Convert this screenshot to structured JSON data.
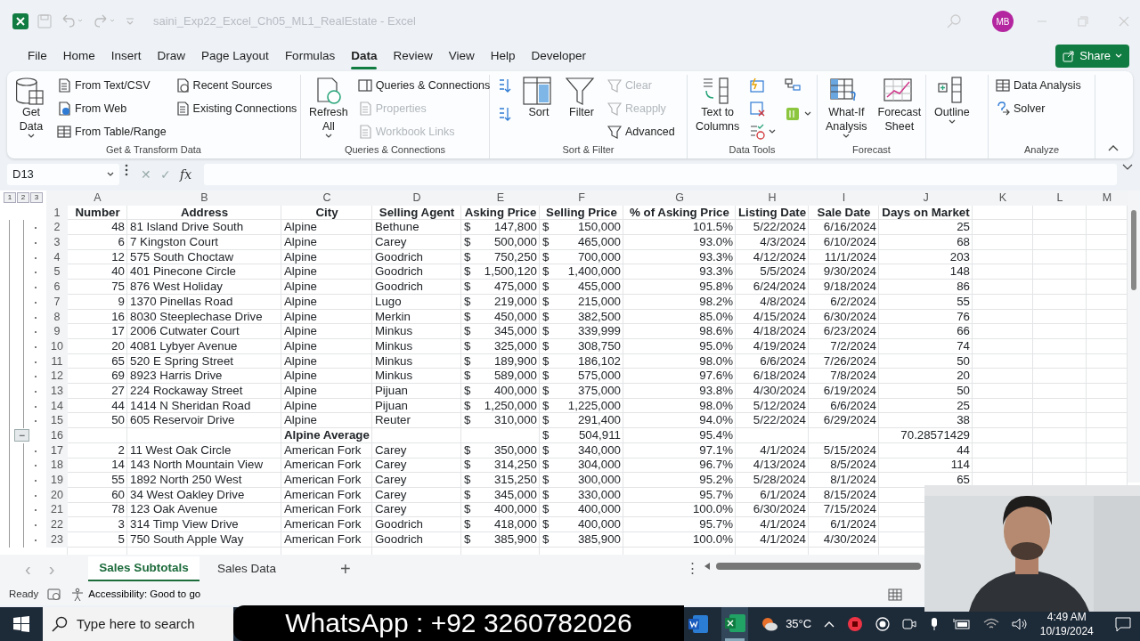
{
  "title_bar": {
    "title": "saini_Exp22_Excel_Ch05_ML1_RealEstate  -  Excel",
    "avatar": "MB"
  },
  "menu_tabs": [
    {
      "label": "File",
      "selected": false
    },
    {
      "label": "Home",
      "selected": false
    },
    {
      "label": "Insert",
      "selected": false
    },
    {
      "label": "Draw",
      "selected": false
    },
    {
      "label": "Page Layout",
      "selected": false
    },
    {
      "label": "Formulas",
      "selected": false
    },
    {
      "label": "Data",
      "selected": true
    },
    {
      "label": "Review",
      "selected": false
    },
    {
      "label": "View",
      "selected": false
    },
    {
      "label": "Help",
      "selected": false
    },
    {
      "label": "Developer",
      "selected": false
    }
  ],
  "share_button": {
    "label": "Share"
  },
  "ribbon": [
    {
      "label": "Get & Transform Data",
      "columns": [
        [
          {
            "kind": "large",
            "lines": [
              "Get",
              "Data"
            ],
            "dropdown": true,
            "disabled": false
          }
        ],
        [
          {
            "kind": "small",
            "label": "From Text/CSV",
            "disabled": false
          },
          {
            "kind": "small",
            "label": "From Web",
            "disabled": false
          },
          {
            "kind": "small",
            "label": "From Table/Range",
            "disabled": false
          }
        ],
        [
          {
            "kind": "small",
            "label": "Recent Sources",
            "disabled": false
          },
          {
            "kind": "small",
            "label": "Existing Connections",
            "disabled": false
          }
        ]
      ]
    },
    {
      "label": "Queries & Connections",
      "columns": [
        [
          {
            "kind": "large",
            "lines": [
              "Refresh",
              "All"
            ],
            "dropdown": true,
            "disabled": false
          }
        ],
        [
          {
            "kind": "small",
            "label": "Queries & Connections",
            "disabled": false
          },
          {
            "kind": "small",
            "label": "Properties",
            "disabled": true
          },
          {
            "kind": "small",
            "label": "Workbook Links",
            "disabled": true
          }
        ]
      ]
    },
    {
      "label": "Sort & Filter",
      "columns": [
        [
          {
            "kind": "icon",
            "disabled": false
          },
          {
            "kind": "icon",
            "disabled": false
          }
        ],
        [
          {
            "kind": "large",
            "lines": [
              "Sort"
            ],
            "disabled": false
          }
        ],
        [
          {
            "kind": "large",
            "lines": [
              "Filter"
            ],
            "disabled": false
          }
        ],
        [
          {
            "kind": "small",
            "label": "Clear",
            "disabled": true
          },
          {
            "kind": "small",
            "label": "Reapply",
            "disabled": true
          },
          {
            "kind": "small",
            "label": "Advanced",
            "disabled": false
          }
        ]
      ]
    },
    {
      "label": "Data Tools",
      "columns": [
        [
          {
            "kind": "large",
            "lines": [
              "Text to",
              "Columns"
            ],
            "disabled": false
          }
        ],
        [
          {
            "kind": "icon",
            "disabled": false
          },
          {
            "kind": "icon",
            "disabled": false
          },
          {
            "kind": "icon",
            "dropdown": true,
            "disabled": false
          }
        ],
        [
          {
            "kind": "icon",
            "disabled": false
          },
          {
            "kind": "icon",
            "dropdown": true,
            "disabled": false
          }
        ]
      ]
    },
    {
      "label": "Forecast",
      "columns": [
        [
          {
            "kind": "large",
            "lines": [
              "What-If",
              "Analysis"
            ],
            "dropdown": true,
            "disabled": false
          }
        ],
        [
          {
            "kind": "large",
            "lines": [
              "Forecast",
              "Sheet"
            ],
            "disabled": false
          }
        ]
      ]
    },
    {
      "columns": [
        [
          {
            "kind": "large",
            "lines": [
              "Outline"
            ],
            "dropdown": true,
            "disabled": false
          }
        ]
      ]
    },
    {
      "label": "Analyze",
      "columns": [
        [
          {
            "kind": "small",
            "label": "Data Analysis",
            "disabled": false
          },
          {
            "kind": "small",
            "label": "Solver",
            "disabled": false
          }
        ]
      ]
    }
  ],
  "formula_bar": {
    "name_box": "D13",
    "cancel": "✕",
    "enter": "✓",
    "fx": "fx"
  },
  "outline_levels": [
    "1",
    "2",
    "3"
  ],
  "columns": [
    "A",
    "B",
    "C",
    "D",
    "E",
    "F",
    "G",
    "H",
    "I",
    "J",
    "K",
    "L",
    "M"
  ],
  "rows": [
    {
      "n": "1",
      "kind": "header",
      "detail": false,
      "cells": [
        "Number",
        "Address",
        "City",
        "Selling Agent",
        "Asking Price",
        "Selling Price",
        "% of Asking Price",
        "Listing Date",
        "Sale Date",
        "Days on Market"
      ]
    },
    {
      "n": "2",
      "kind": "data",
      "detail": true,
      "cells": [
        "48",
        "81 Island Drive South",
        "Alpine",
        "Bethune",
        {
          "sym": "$",
          "val": "147,800"
        },
        {
          "sym": "$",
          "val": "150,000"
        },
        "101.5%",
        "5/22/2024",
        "6/16/2024",
        "25"
      ]
    },
    {
      "n": "3",
      "kind": "data",
      "detail": true,
      "cells": [
        "6",
        "7 Kingston Court",
        "Alpine",
        "Carey",
        {
          "sym": "$",
          "val": "500,000"
        },
        {
          "sym": "$",
          "val": "465,000"
        },
        "93.0%",
        "4/3/2024",
        "6/10/2024",
        "68"
      ]
    },
    {
      "n": "4",
      "kind": "data",
      "detail": true,
      "cells": [
        "12",
        "575 South Choctaw",
        "Alpine",
        "Goodrich",
        {
          "sym": "$",
          "val": "750,250"
        },
        {
          "sym": "$",
          "val": "700,000"
        },
        "93.3%",
        "4/12/2024",
        "11/1/2024",
        "203"
      ]
    },
    {
      "n": "5",
      "kind": "data",
      "detail": true,
      "cells": [
        "40",
        "401 Pinecone Circle",
        "Alpine",
        "Goodrich",
        {
          "sym": "$",
          "val": "1,500,120"
        },
        {
          "sym": "$",
          "val": "1,400,000"
        },
        "93.3%",
        "5/5/2024",
        "9/30/2024",
        "148"
      ]
    },
    {
      "n": "6",
      "kind": "data",
      "detail": true,
      "cells": [
        "75",
        "876 West Holiday",
        "Alpine",
        "Goodrich",
        {
          "sym": "$",
          "val": "475,000"
        },
        {
          "sym": "$",
          "val": "455,000"
        },
        "95.8%",
        "6/24/2024",
        "9/18/2024",
        "86"
      ]
    },
    {
      "n": "7",
      "kind": "data",
      "detail": true,
      "cells": [
        "9",
        "1370 Pinellas Road",
        "Alpine",
        "Lugo",
        {
          "sym": "$",
          "val": "219,000"
        },
        {
          "sym": "$",
          "val": "215,000"
        },
        "98.2%",
        "4/8/2024",
        "6/2/2024",
        "55"
      ]
    },
    {
      "n": "8",
      "kind": "data",
      "detail": true,
      "cells": [
        "16",
        "8030 Steeplechase Drive",
        "Alpine",
        "Merkin",
        {
          "sym": "$",
          "val": "450,000"
        },
        {
          "sym": "$",
          "val": "382,500"
        },
        "85.0%",
        "4/15/2024",
        "6/30/2024",
        "76"
      ]
    },
    {
      "n": "9",
      "kind": "data",
      "detail": true,
      "cells": [
        "17",
        "2006 Cutwater Court",
        "Alpine",
        "Minkus",
        {
          "sym": "$",
          "val": "345,000"
        },
        {
          "sym": "$",
          "val": "339,999"
        },
        "98.6%",
        "4/18/2024",
        "6/23/2024",
        "66"
      ]
    },
    {
      "n": "10",
      "kind": "data",
      "detail": true,
      "cells": [
        "20",
        "4081 Lybyer Avenue",
        "Alpine",
        "Minkus",
        {
          "sym": "$",
          "val": "325,000"
        },
        {
          "sym": "$",
          "val": "308,750"
        },
        "95.0%",
        "4/19/2024",
        "7/2/2024",
        "74"
      ]
    },
    {
      "n": "11",
      "kind": "data",
      "detail": true,
      "cells": [
        "65",
        "520 E Spring Street",
        "Alpine",
        "Minkus",
        {
          "sym": "$",
          "val": "189,900"
        },
        {
          "sym": "$",
          "val": "186,102"
        },
        "98.0%",
        "6/6/2024",
        "7/26/2024",
        "50"
      ]
    },
    {
      "n": "12",
      "kind": "data",
      "detail": true,
      "cells": [
        "69",
        "8923 Harris Drive",
        "Alpine",
        "Minkus",
        {
          "sym": "$",
          "val": "589,000"
        },
        {
          "sym": "$",
          "val": "575,000"
        },
        "97.6%",
        "6/18/2024",
        "7/8/2024",
        "20"
      ]
    },
    {
      "n": "13",
      "kind": "data",
      "detail": true,
      "cells": [
        "27",
        "224 Rockaway Street",
        "Alpine",
        "Pijuan",
        {
          "sym": "$",
          "val": "400,000"
        },
        {
          "sym": "$",
          "val": "375,000"
        },
        "93.8%",
        "4/30/2024",
        "6/19/2024",
        "50"
      ]
    },
    {
      "n": "14",
      "kind": "data",
      "detail": true,
      "cells": [
        "44",
        "1414 N Sheridan Road",
        "Alpine",
        "Pijuan",
        {
          "sym": "$",
          "val": "1,250,000"
        },
        {
          "sym": "$",
          "val": "1,225,000"
        },
        "98.0%",
        "5/12/2024",
        "6/6/2024",
        "25"
      ]
    },
    {
      "n": "15",
      "kind": "data",
      "detail": true,
      "cells": [
        "50",
        "605 Reservoir Drive",
        "Alpine",
        "Reuter",
        {
          "sym": "$",
          "val": "310,000"
        },
        {
          "sym": "$",
          "val": "291,400"
        },
        "94.0%",
        "5/22/2024",
        "6/29/2024",
        "38"
      ]
    },
    {
      "n": "16",
      "kind": "subtotal",
      "detail": false,
      "outline_button": "−",
      "cells": [
        null,
        null,
        "Alpine Average",
        null,
        null,
        {
          "sym": "$",
          "val": "504,911"
        },
        "95.4%",
        null,
        null,
        "70.28571429"
      ]
    },
    {
      "n": "17",
      "kind": "data",
      "detail": true,
      "cells": [
        "2",
        "11 West Oak Circle",
        "American Fork",
        "Carey",
        {
          "sym": "$",
          "val": "350,000"
        },
        {
          "sym": "$",
          "val": "340,000"
        },
        "97.1%",
        "4/1/2024",
        "5/15/2024",
        "44"
      ]
    },
    {
      "n": "18",
      "kind": "data",
      "detail": true,
      "cells": [
        "14",
        "143 North Mountain View",
        "American Fork",
        "Carey",
        {
          "sym": "$",
          "val": "314,250"
        },
        {
          "sym": "$",
          "val": "304,000"
        },
        "96.7%",
        "4/13/2024",
        "8/5/2024",
        "114"
      ]
    },
    {
      "n": "19",
      "kind": "data",
      "detail": true,
      "cells": [
        "55",
        "1892 North 250 West",
        "American Fork",
        "Carey",
        {
          "sym": "$",
          "val": "315,250"
        },
        {
          "sym": "$",
          "val": "300,000"
        },
        "95.2%",
        "5/28/2024",
        "8/1/2024",
        "65"
      ]
    },
    {
      "n": "20",
      "kind": "data",
      "detail": true,
      "cells": [
        "60",
        "34 West Oakley Drive",
        "American Fork",
        "Carey",
        {
          "sym": "$",
          "val": "345,000"
        },
        {
          "sym": "$",
          "val": "330,000"
        },
        "95.7%",
        "6/1/2024",
        "8/15/2024",
        null
      ]
    },
    {
      "n": "21",
      "kind": "data",
      "detail": true,
      "cells": [
        "78",
        "123 Oak Avenue",
        "American Fork",
        "Carey",
        {
          "sym": "$",
          "val": "400,000"
        },
        {
          "sym": "$",
          "val": "400,000"
        },
        "100.0%",
        "6/30/2024",
        "7/15/2024",
        null
      ]
    },
    {
      "n": "22",
      "kind": "data",
      "detail": true,
      "cells": [
        "3",
        "314 Timp View Drive",
        "American Fork",
        "Goodrich",
        {
          "sym": "$",
          "val": "418,000"
        },
        {
          "sym": "$",
          "val": "400,000"
        },
        "95.7%",
        "4/1/2024",
        "6/1/2024",
        null
      ]
    },
    {
      "n": "23",
      "kind": "data",
      "detail": true,
      "cells": [
        "5",
        "750 South Apple Way",
        "American Fork",
        "Goodrich",
        {
          "sym": "$",
          "val": "385,900"
        },
        {
          "sym": "$",
          "val": "385,900"
        },
        "100.0%",
        "4/1/2024",
        "4/30/2024",
        null
      ]
    }
  ],
  "sheet_tabs": [
    {
      "label": "Sales Subtotals",
      "selected": true
    },
    {
      "label": "Sales Data",
      "selected": false
    }
  ],
  "sheet_nav": {
    "prev": "‹",
    "next": "›",
    "add": "+",
    "more": "⋮"
  },
  "status_bar": {
    "state": "Ready",
    "accessibility": "Accessibility: Good to go"
  },
  "taskbar": {
    "search_placeholder": "Type here to search",
    "weather": "35°C",
    "time": "4:49 AM",
    "date": "10/19/2024"
  },
  "banner": {
    "text": "WhatsApp : +92 3260782026"
  },
  "webcam": {
    "kind": "picture"
  }
}
